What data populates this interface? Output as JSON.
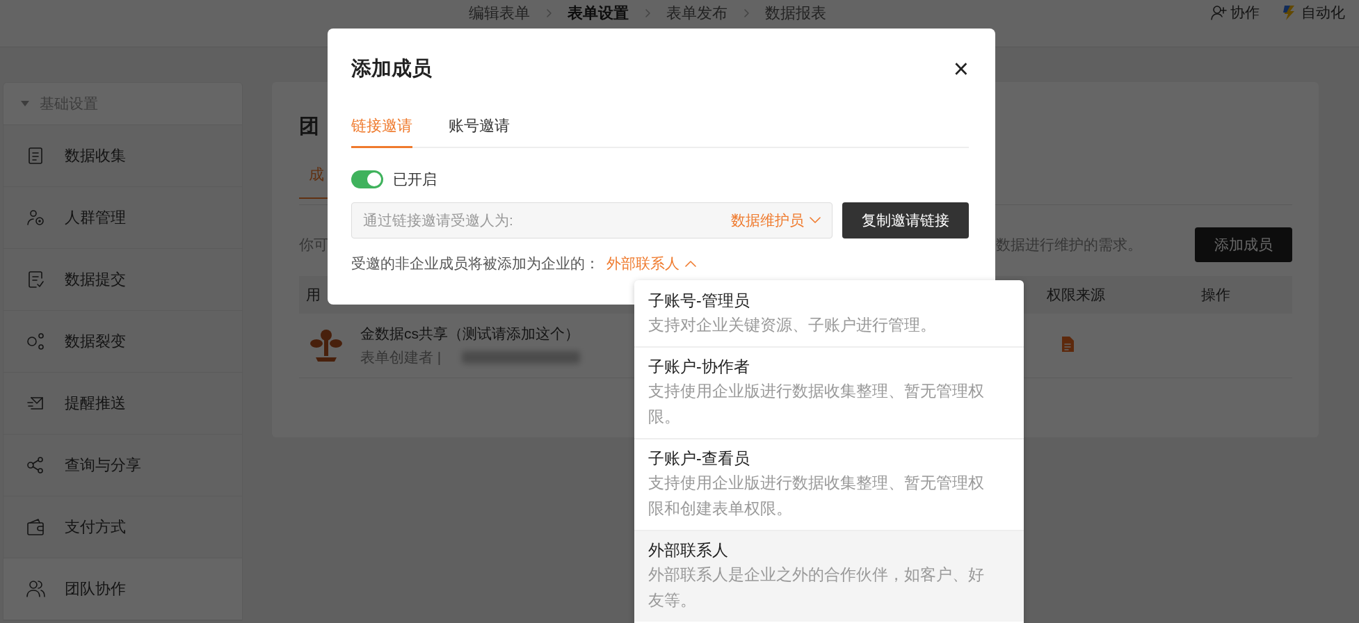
{
  "top_bar": {
    "steps": [
      {
        "label": "编辑表单",
        "selected": false
      },
      {
        "label": "表单设置",
        "selected": true
      },
      {
        "label": "表单发布",
        "selected": false
      },
      {
        "label": "数据报表",
        "selected": false
      }
    ],
    "actions": [
      {
        "label": "协作",
        "kind": "collab"
      },
      {
        "label": "自动化",
        "kind": "automation"
      }
    ]
  },
  "sidebar": {
    "section": {
      "label": "基础设置",
      "expanded": true
    },
    "items": [
      {
        "label": "数据收集",
        "kind": "doc",
        "selected": false
      },
      {
        "label": "人群管理",
        "kind": "people",
        "selected": false
      },
      {
        "label": "数据提交",
        "kind": "submit",
        "selected": false
      },
      {
        "label": "数据裂变",
        "kind": "fission",
        "selected": false
      },
      {
        "label": "提醒推送",
        "kind": "mail",
        "selected": false
      },
      {
        "label": "查询与分享",
        "kind": "share",
        "selected": false
      },
      {
        "label": "支付方式",
        "kind": "wallet",
        "selected": false
      },
      {
        "label": "团队协作",
        "kind": "team",
        "selected": true
      }
    ]
  },
  "main": {
    "title": "团",
    "tab": "成",
    "intro_left": "你可",
    "intro_right": "数据进行维护的需求。",
    "add_button": "添加成员",
    "columns": [
      "用",
      "权限来源",
      "操作"
    ],
    "rows": [
      {
        "name": "金数据cs共享（测试请添加这个）",
        "role": "表单创建者 |"
      }
    ]
  },
  "dialog": {
    "title": "添加成员",
    "close": "×",
    "tabs": [
      {
        "label": "链接邀请",
        "selected": true
      },
      {
        "label": "账号邀请",
        "selected": false
      }
    ],
    "link_switch": {
      "on": true,
      "label": "已开启"
    },
    "invite_field": {
      "prefix": "通过链接邀请受邀人为:",
      "role": "数据维护员"
    },
    "copy_button": "复制邀请链接",
    "member_type": {
      "label": "受邀的非企业成员将被添加为企业的：",
      "value": "外部联系人",
      "expanded": true
    }
  },
  "dropdown": {
    "options": [
      {
        "title": "子账号-管理员",
        "description": "支持对企业关键资源、子账户进行管理。",
        "selected": false
      },
      {
        "title": "子账户-协作者",
        "description": "支持使用企业版进行数据收集整理、暂无管理权限。",
        "selected": false
      },
      {
        "title": "子账户-查看员",
        "description": "支持使用企业版进行数据收集整理、暂无管理权限和创建表单权限。",
        "selected": false
      },
      {
        "title": "外部联系人",
        "description": "外部联系人是企业之外的合作伙伴，如客户、好友等。",
        "selected": true
      }
    ]
  }
}
